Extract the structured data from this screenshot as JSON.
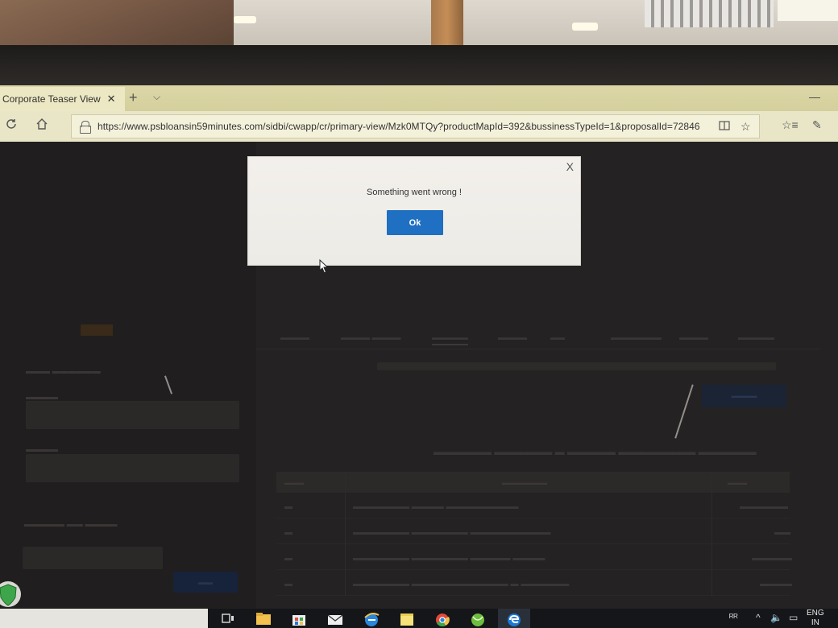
{
  "browser": {
    "tab_title": "Corporate Teaser View",
    "tab_close": "✕",
    "new_tab": "+",
    "tab_menu": "⌵",
    "url": "https://www.psbloansin59minutes.com/sidbi/cwapp/cr/primary-view/Mzk0MTQy?productMapId=392&bussinessTypeId=1&proposalId=72846",
    "icons": [
      "refresh-icon",
      "home-icon",
      "lock-icon",
      "reading-view-icon",
      "favorite-star-icon",
      "favorites-hub-icon",
      "pen-icon"
    ]
  },
  "dialog": {
    "close_label": "X",
    "message": "Something went wrong !",
    "ok_label": "Ok"
  },
  "taskbar": {
    "language": "ENG",
    "region": "IN",
    "colors": {
      "edge": "#1e78d6",
      "chrome": "#e24a3a"
    }
  },
  "colors": {
    "ok_button": "#1f6fc2",
    "browser_chrome": "#e9e6c8"
  }
}
